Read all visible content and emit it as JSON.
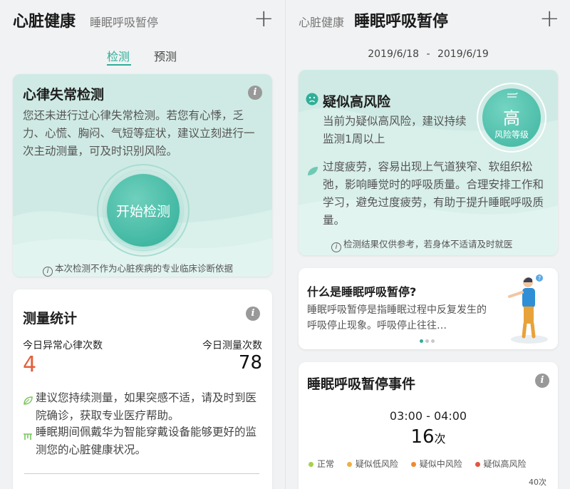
{
  "left": {
    "title": "心脏健康",
    "subtitle": "睡眠呼吸暂停",
    "add_symbol": "+",
    "tabs": [
      {
        "label": "检测",
        "active": true
      },
      {
        "label": "预测",
        "active": false
      }
    ],
    "arrhythmia_card": {
      "title": "心律失常检测",
      "body": "您还未进行过心律失常检测。若您有心悸，乏力、心慌、胸闷、气短等症状，建议立刻进行一次主动测量，可及时识别风险。",
      "start_button": "开始检测",
      "disclaimer": "本次检测不作为心脏疾病的专业临床诊断依据"
    },
    "stats_card": {
      "title": "测量统计",
      "abnormal_label": "今日异常心律次数",
      "abnormal_value": "4",
      "count_label": "今日测量次数",
      "count_value": "78",
      "tip1": "建议您持续测量，如果突感不适，请及时到医院确诊，获取专业医疗帮助。",
      "tip2": "睡眠期间佩戴华为智能穿戴设备能够更好的监测您的心脏健康状况。"
    }
  },
  "right": {
    "subtitle": "心脏健康",
    "title": "睡眠呼吸暂停",
    "add_symbol": "+",
    "date_start": "2019/6/18",
    "date_sep": "-",
    "date_end": "2019/6/19",
    "risk_card": {
      "title": "疑似高风险",
      "desc": "当前为疑似高风险，建议持续监测1周以上",
      "level": "高",
      "level_label": "风险等级",
      "advice": "过度疲劳，容易出现上气道狭窄、软组织松弛，影响睡觉时的呼吸质量。合理安排工作和学习，避免过度疲劳，有助于提升睡眠呼吸质量。",
      "disclaimer": "检测结果仅供参考，若身体不适请及时就医"
    },
    "info_card": {
      "title": "什么是睡眠呼吸暂停?",
      "body": "睡眠呼吸暂停是指睡眠过程中反复发生的呼吸停止现象。呼吸停止往往…"
    },
    "events_card": {
      "title": "睡眠呼吸暂停事件",
      "time_range": "03:00 - 04:00",
      "count": "16",
      "count_unit": "次",
      "legend": [
        {
          "label": "正常",
          "color": "#a6d14a"
        },
        {
          "label": "疑似低风险",
          "color": "#f0b040"
        },
        {
          "label": "疑似中风险",
          "color": "#ef8a2c"
        },
        {
          "label": "疑似高风险",
          "color": "#e4553f"
        }
      ],
      "axis_max": "40次"
    }
  },
  "colors": {
    "teal": "#2fae98",
    "teal_light": "#cfeae4",
    "alert_orange": "#e2613c"
  }
}
